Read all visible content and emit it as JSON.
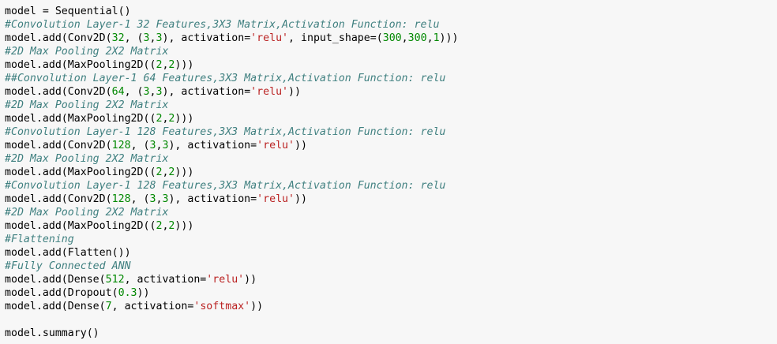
{
  "colors": {
    "comment": "#408080",
    "string": "#BA2121",
    "number": "#008800",
    "background": "#f7f7f7"
  },
  "code_lines": [
    [
      [
        "model = Sequential()",
        "t"
      ]
    ],
    [
      [
        "#Convolution Layer-1 32 Features,3X3 Matrix,Activation Function: relu",
        "c"
      ]
    ],
    [
      [
        "model.add(Conv2D(",
        "t"
      ],
      [
        "32",
        "n"
      ],
      [
        ", (",
        "t"
      ],
      [
        "3",
        "n"
      ],
      [
        ",",
        "t"
      ],
      [
        "3",
        "n"
      ],
      [
        "), activation=",
        "t"
      ],
      [
        "'relu'",
        "s"
      ],
      [
        ", input_shape=(",
        "t"
      ],
      [
        "300",
        "n"
      ],
      [
        ",",
        "t"
      ],
      [
        "300",
        "n"
      ],
      [
        ",",
        "t"
      ],
      [
        "1",
        "n"
      ],
      [
        ")))",
        "t"
      ]
    ],
    [
      [
        "#2D Max Pooling 2X2 Matrix",
        "c"
      ]
    ],
    [
      [
        "model.add(MaxPooling2D((",
        "t"
      ],
      [
        "2",
        "n"
      ],
      [
        ",",
        "t"
      ],
      [
        "2",
        "n"
      ],
      [
        ")))",
        "t"
      ]
    ],
    [
      [
        "##Convolution Layer-1 64 Features,3X3 Matrix,Activation Function: relu",
        "c"
      ]
    ],
    [
      [
        "model.add(Conv2D(",
        "t"
      ],
      [
        "64",
        "n"
      ],
      [
        ", (",
        "t"
      ],
      [
        "3",
        "n"
      ],
      [
        ",",
        "t"
      ],
      [
        "3",
        "n"
      ],
      [
        "), activation=",
        "t"
      ],
      [
        "'relu'",
        "s"
      ],
      [
        "))",
        "t"
      ]
    ],
    [
      [
        "#2D Max Pooling 2X2 Matrix",
        "c"
      ]
    ],
    [
      [
        "model.add(MaxPooling2D((",
        "t"
      ],
      [
        "2",
        "n"
      ],
      [
        ",",
        "t"
      ],
      [
        "2",
        "n"
      ],
      [
        ")))",
        "t"
      ]
    ],
    [
      [
        "#Convolution Layer-1 128 Features,3X3 Matrix,Activation Function: relu",
        "c"
      ]
    ],
    [
      [
        "model.add(Conv2D(",
        "t"
      ],
      [
        "128",
        "n"
      ],
      [
        ", (",
        "t"
      ],
      [
        "3",
        "n"
      ],
      [
        ",",
        "t"
      ],
      [
        "3",
        "n"
      ],
      [
        "), activation=",
        "t"
      ],
      [
        "'relu'",
        "s"
      ],
      [
        "))",
        "t"
      ]
    ],
    [
      [
        "#2D Max Pooling 2X2 Matrix",
        "c"
      ]
    ],
    [
      [
        "model.add(MaxPooling2D((",
        "t"
      ],
      [
        "2",
        "n"
      ],
      [
        ",",
        "t"
      ],
      [
        "2",
        "n"
      ],
      [
        ")))",
        "t"
      ]
    ],
    [
      [
        "#Convolution Layer-1 128 Features,3X3 Matrix,Activation Function: relu",
        "c"
      ]
    ],
    [
      [
        "model.add(Conv2D(",
        "t"
      ],
      [
        "128",
        "n"
      ],
      [
        ", (",
        "t"
      ],
      [
        "3",
        "n"
      ],
      [
        ",",
        "t"
      ],
      [
        "3",
        "n"
      ],
      [
        "), activation=",
        "t"
      ],
      [
        "'relu'",
        "s"
      ],
      [
        "))",
        "t"
      ]
    ],
    [
      [
        "#2D Max Pooling 2X2 Matrix",
        "c"
      ]
    ],
    [
      [
        "model.add(MaxPooling2D((",
        "t"
      ],
      [
        "2",
        "n"
      ],
      [
        ",",
        "t"
      ],
      [
        "2",
        "n"
      ],
      [
        ")))",
        "t"
      ]
    ],
    [
      [
        "#Flattening",
        "c"
      ]
    ],
    [
      [
        "model.add(Flatten())",
        "t"
      ]
    ],
    [
      [
        "#Fully Connected ANN",
        "c"
      ]
    ],
    [
      [
        "model.add(Dense(",
        "t"
      ],
      [
        "512",
        "n"
      ],
      [
        ", activation=",
        "t"
      ],
      [
        "'relu'",
        "s"
      ],
      [
        "))",
        "t"
      ]
    ],
    [
      [
        "model.add(Dropout(",
        "t"
      ],
      [
        "0.3",
        "n"
      ],
      [
        "))",
        "t"
      ]
    ],
    [
      [
        "model.add(Dense(",
        "t"
      ],
      [
        "7",
        "n"
      ],
      [
        ", activation=",
        "t"
      ],
      [
        "'softmax'",
        "s"
      ],
      [
        "))",
        "t"
      ]
    ],
    [],
    [
      [
        "model.summary()",
        "t"
      ]
    ]
  ]
}
